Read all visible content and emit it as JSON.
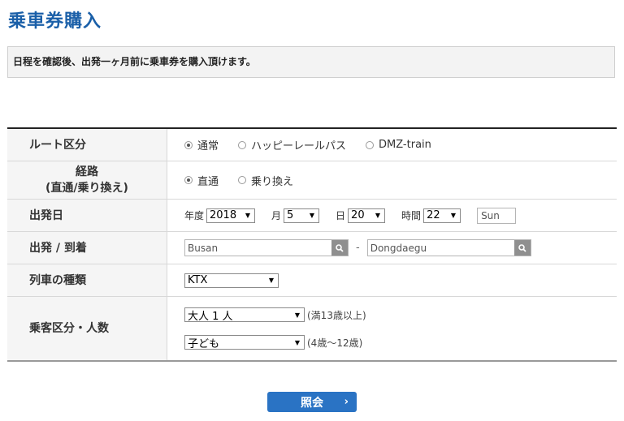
{
  "page": {
    "title": "乗車券購入"
  },
  "notice": {
    "text": "日程を確認後、出発一ヶ月前に乗車券を購入頂けます。"
  },
  "form": {
    "route_type": {
      "label": "ルート区分",
      "options": [
        {
          "label": "通常",
          "checked": true
        },
        {
          "label": "ハッピーレールパス",
          "checked": false
        },
        {
          "label": "DMZ-train",
          "checked": false
        }
      ]
    },
    "course": {
      "label_line1": "経路",
      "label_line2": "(直通/乗り換え)",
      "options": [
        {
          "label": "直通",
          "checked": true
        },
        {
          "label": "乗り換え",
          "checked": false
        }
      ]
    },
    "departure_date": {
      "label": "出発日",
      "year_label": "年度",
      "year": "2018",
      "month_label": "月",
      "month": "5",
      "day_label": "日",
      "day": "20",
      "hour_label": "時間",
      "hour": "22",
      "weekday": "Sun"
    },
    "stations": {
      "label": "出発 / 到着",
      "from": "Busan",
      "separator": "-",
      "to": "Dongdaegu"
    },
    "train_type": {
      "label": "列車の種類",
      "value": "KTX"
    },
    "passengers": {
      "label": "乗客区分・人数",
      "adult": {
        "value": "大人 1 人",
        "note": "(満13歳以上)"
      },
      "child": {
        "value": "子ども",
        "note": "(4歳〜12歳)"
      }
    }
  },
  "submit": {
    "label": "照会"
  }
}
